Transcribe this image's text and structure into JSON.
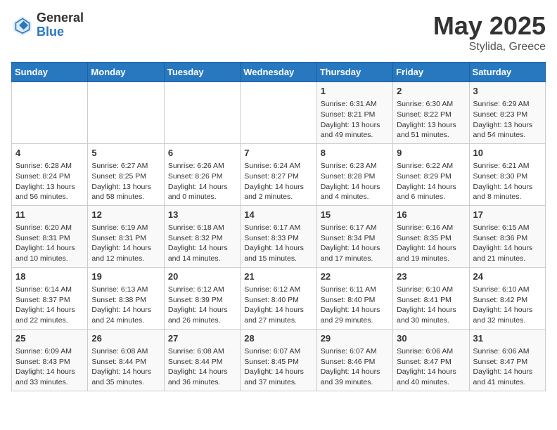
{
  "header": {
    "logo_general": "General",
    "logo_blue": "Blue",
    "title": "May 2025",
    "location": "Stylida, Greece"
  },
  "days_of_week": [
    "Sunday",
    "Monday",
    "Tuesday",
    "Wednesday",
    "Thursday",
    "Friday",
    "Saturday"
  ],
  "weeks": [
    [
      {
        "day": "",
        "content": ""
      },
      {
        "day": "",
        "content": ""
      },
      {
        "day": "",
        "content": ""
      },
      {
        "day": "",
        "content": ""
      },
      {
        "day": "1",
        "content": "Sunrise: 6:31 AM\nSunset: 8:21 PM\nDaylight: 13 hours and 49 minutes."
      },
      {
        "day": "2",
        "content": "Sunrise: 6:30 AM\nSunset: 8:22 PM\nDaylight: 13 hours and 51 minutes."
      },
      {
        "day": "3",
        "content": "Sunrise: 6:29 AM\nSunset: 8:23 PM\nDaylight: 13 hours and 54 minutes."
      }
    ],
    [
      {
        "day": "4",
        "content": "Sunrise: 6:28 AM\nSunset: 8:24 PM\nDaylight: 13 hours and 56 minutes."
      },
      {
        "day": "5",
        "content": "Sunrise: 6:27 AM\nSunset: 8:25 PM\nDaylight: 13 hours and 58 minutes."
      },
      {
        "day": "6",
        "content": "Sunrise: 6:26 AM\nSunset: 8:26 PM\nDaylight: 14 hours and 0 minutes."
      },
      {
        "day": "7",
        "content": "Sunrise: 6:24 AM\nSunset: 8:27 PM\nDaylight: 14 hours and 2 minutes."
      },
      {
        "day": "8",
        "content": "Sunrise: 6:23 AM\nSunset: 8:28 PM\nDaylight: 14 hours and 4 minutes."
      },
      {
        "day": "9",
        "content": "Sunrise: 6:22 AM\nSunset: 8:29 PM\nDaylight: 14 hours and 6 minutes."
      },
      {
        "day": "10",
        "content": "Sunrise: 6:21 AM\nSunset: 8:30 PM\nDaylight: 14 hours and 8 minutes."
      }
    ],
    [
      {
        "day": "11",
        "content": "Sunrise: 6:20 AM\nSunset: 8:31 PM\nDaylight: 14 hours and 10 minutes."
      },
      {
        "day": "12",
        "content": "Sunrise: 6:19 AM\nSunset: 8:31 PM\nDaylight: 14 hours and 12 minutes."
      },
      {
        "day": "13",
        "content": "Sunrise: 6:18 AM\nSunset: 8:32 PM\nDaylight: 14 hours and 14 minutes."
      },
      {
        "day": "14",
        "content": "Sunrise: 6:17 AM\nSunset: 8:33 PM\nDaylight: 14 hours and 15 minutes."
      },
      {
        "day": "15",
        "content": "Sunrise: 6:17 AM\nSunset: 8:34 PM\nDaylight: 14 hours and 17 minutes."
      },
      {
        "day": "16",
        "content": "Sunrise: 6:16 AM\nSunset: 8:35 PM\nDaylight: 14 hours and 19 minutes."
      },
      {
        "day": "17",
        "content": "Sunrise: 6:15 AM\nSunset: 8:36 PM\nDaylight: 14 hours and 21 minutes."
      }
    ],
    [
      {
        "day": "18",
        "content": "Sunrise: 6:14 AM\nSunset: 8:37 PM\nDaylight: 14 hours and 22 minutes."
      },
      {
        "day": "19",
        "content": "Sunrise: 6:13 AM\nSunset: 8:38 PM\nDaylight: 14 hours and 24 minutes."
      },
      {
        "day": "20",
        "content": "Sunrise: 6:12 AM\nSunset: 8:39 PM\nDaylight: 14 hours and 26 minutes."
      },
      {
        "day": "21",
        "content": "Sunrise: 6:12 AM\nSunset: 8:40 PM\nDaylight: 14 hours and 27 minutes."
      },
      {
        "day": "22",
        "content": "Sunrise: 6:11 AM\nSunset: 8:40 PM\nDaylight: 14 hours and 29 minutes."
      },
      {
        "day": "23",
        "content": "Sunrise: 6:10 AM\nSunset: 8:41 PM\nDaylight: 14 hours and 30 minutes."
      },
      {
        "day": "24",
        "content": "Sunrise: 6:10 AM\nSunset: 8:42 PM\nDaylight: 14 hours and 32 minutes."
      }
    ],
    [
      {
        "day": "25",
        "content": "Sunrise: 6:09 AM\nSunset: 8:43 PM\nDaylight: 14 hours and 33 minutes."
      },
      {
        "day": "26",
        "content": "Sunrise: 6:08 AM\nSunset: 8:44 PM\nDaylight: 14 hours and 35 minutes."
      },
      {
        "day": "27",
        "content": "Sunrise: 6:08 AM\nSunset: 8:44 PM\nDaylight: 14 hours and 36 minutes."
      },
      {
        "day": "28",
        "content": "Sunrise: 6:07 AM\nSunset: 8:45 PM\nDaylight: 14 hours and 37 minutes."
      },
      {
        "day": "29",
        "content": "Sunrise: 6:07 AM\nSunset: 8:46 PM\nDaylight: 14 hours and 39 minutes."
      },
      {
        "day": "30",
        "content": "Sunrise: 6:06 AM\nSunset: 8:47 PM\nDaylight: 14 hours and 40 minutes."
      },
      {
        "day": "31",
        "content": "Sunrise: 6:06 AM\nSunset: 8:47 PM\nDaylight: 14 hours and 41 minutes."
      }
    ]
  ]
}
